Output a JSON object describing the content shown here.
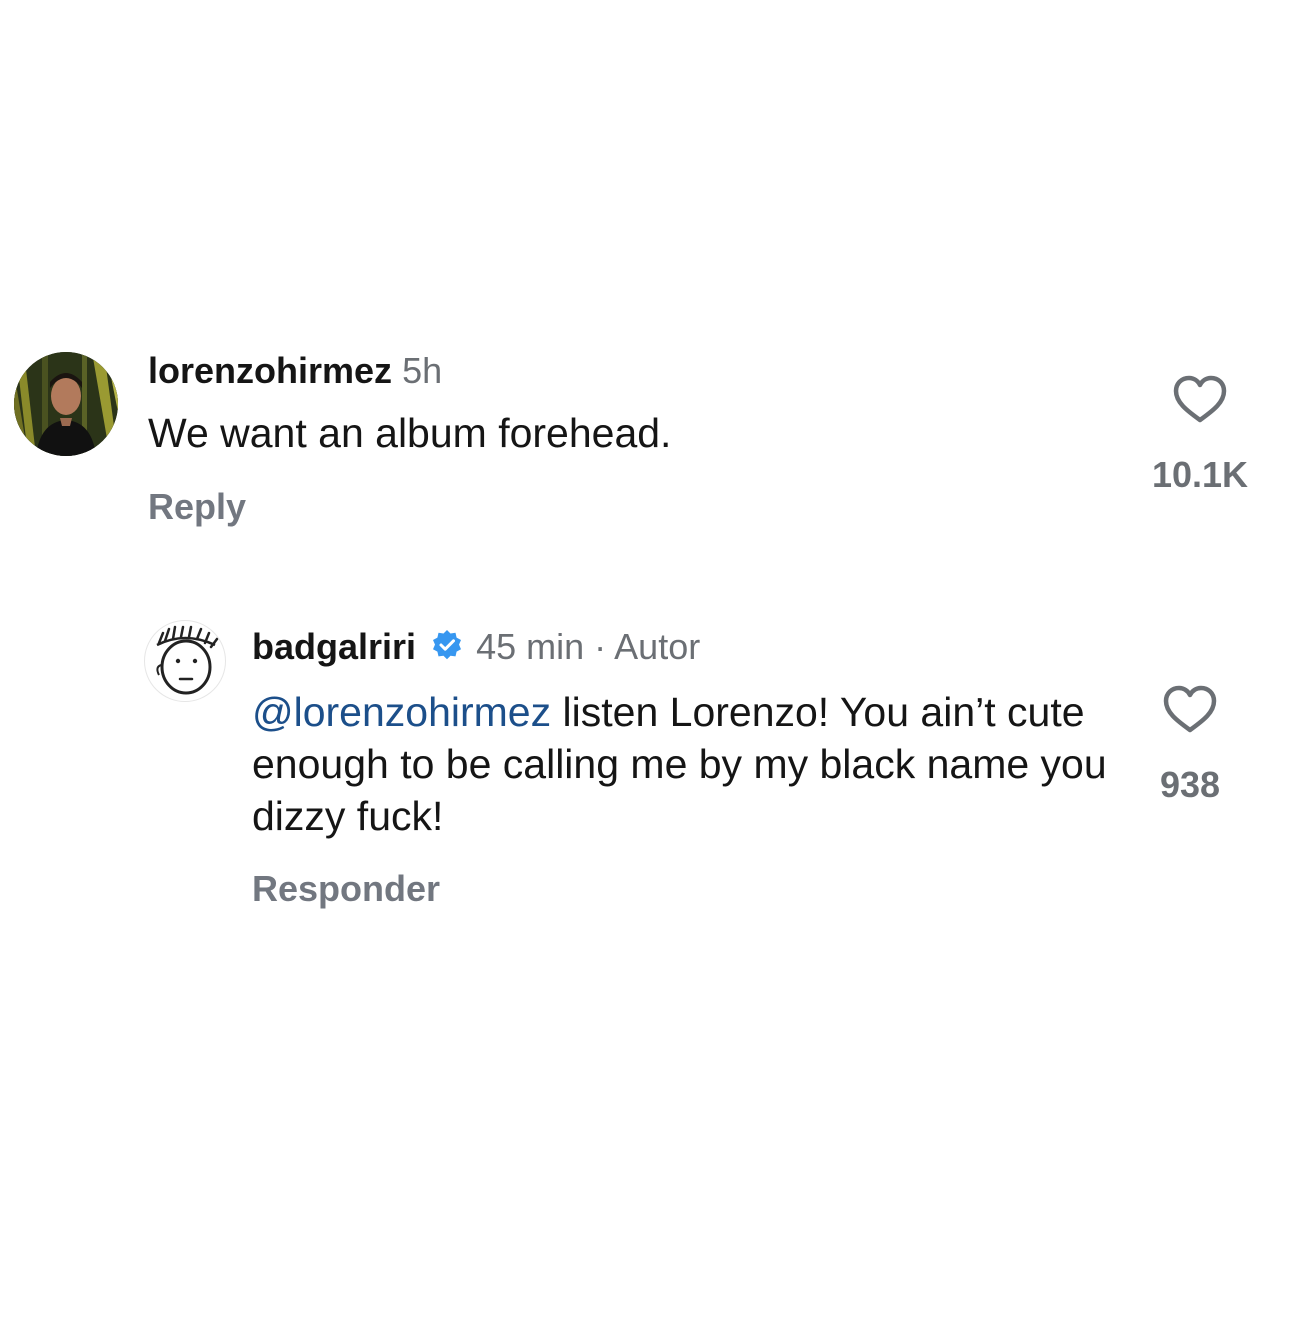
{
  "comments": [
    {
      "username": "lorenzohirmez",
      "time": "5h",
      "text": "We want an album forehead.",
      "reply_label": "Reply",
      "likes": "10.1K",
      "avatar_icon": "profile-photo-avatar",
      "heart_icon": "heart-outline-icon"
    },
    {
      "username": "badgalriri",
      "verified_icon": "verified-badge-icon",
      "time": "45 min",
      "separator": "·",
      "author_label": "Autor",
      "mention": "@lorenzohirmez",
      "text": "listen Lorenzo! You ain’t cute enough to be calling me by my black name you dizzy fuck!",
      "reply_label": "Responder",
      "likes": "938",
      "avatar_icon": "doodle-face-avatar",
      "heart_icon": "heart-outline-icon"
    }
  ],
  "colors": {
    "username": "#151515",
    "meta": "#6b6f74",
    "mention": "#1c4f8a",
    "verified": "#3797f0",
    "reply": "#727780"
  }
}
